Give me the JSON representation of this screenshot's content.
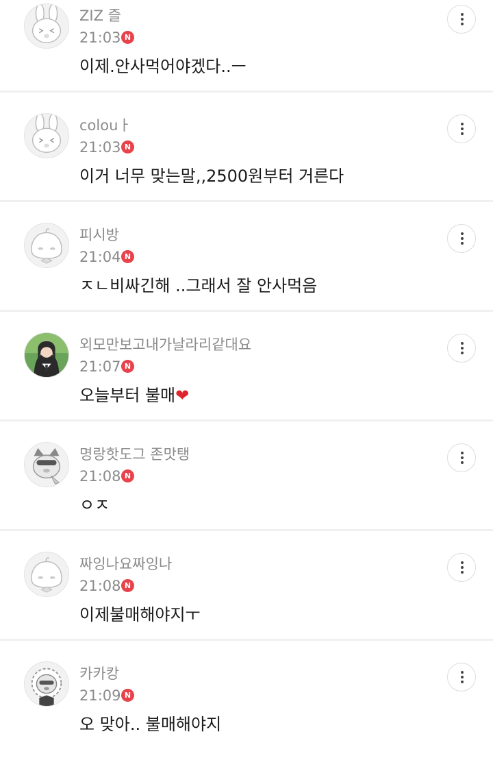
{
  "comments": [
    {
      "nickname": "ZIZ 즐",
      "time": "21:03",
      "badge": "N",
      "text": "이제.안사먹어야겠다..ㅡ",
      "avatar": "rabbit-avatar"
    },
    {
      "nickname": "colouㅏ",
      "time": "21:03",
      "badge": "N",
      "text": "이거 너무 맞는말,,2500원부터 거른다",
      "avatar": "rabbit-avatar"
    },
    {
      "nickname": "피시방",
      "time": "21:04",
      "badge": "N",
      "text": "ㅈㄴ비싸긴해 ..그래서 잘 안사먹음",
      "avatar": "peach-avatar"
    },
    {
      "nickname": "외모만보고내가날라리같대요",
      "time": "21:07",
      "badge": "N",
      "text": "오늘부터 불매",
      "emoji": "❤",
      "avatar": "photo-avatar"
    },
    {
      "nickname": "명랑핫도그 존맛탱",
      "time": "21:08",
      "badge": "N",
      "text": "ㅇㅈ",
      "avatar": "cat-avatar"
    },
    {
      "nickname": "짜잉나요짜잉나",
      "time": "21:08",
      "badge": "N",
      "text": "이제불매해야지ㅜ",
      "avatar": "peach-avatar"
    },
    {
      "nickname": "카카캉",
      "time": "21:09",
      "badge": "N",
      "text": "오 맞아.. 불매해야지",
      "avatar": "lion-avatar"
    }
  ],
  "more_icon": "more-vertical-icon",
  "colors": {
    "badge": "#e8424b",
    "meta": "#8a8a8a",
    "text": "#1a1a1a",
    "divider": "#f0f0f0"
  }
}
